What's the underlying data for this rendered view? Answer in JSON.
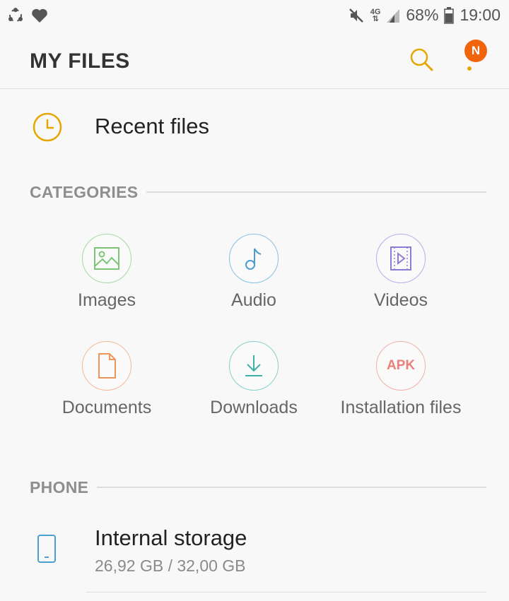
{
  "status_bar": {
    "network": "4G",
    "battery": "68%",
    "time": "19:00"
  },
  "app_bar": {
    "title": "MY FILES",
    "notification_badge": "N"
  },
  "recent": {
    "label": "Recent files"
  },
  "categories": {
    "header": "CATEGORIES",
    "items": [
      {
        "label": "Images",
        "icon": "image-icon",
        "color": "#7cc576"
      },
      {
        "label": "Audio",
        "icon": "music-note-icon",
        "color": "#4a9fd0"
      },
      {
        "label": "Videos",
        "icon": "video-icon",
        "color": "#8f7ad6"
      },
      {
        "label": "Documents",
        "icon": "document-icon",
        "color": "#f0955a"
      },
      {
        "label": "Downloads",
        "icon": "download-icon",
        "color": "#3fb1a6"
      },
      {
        "label": "Installation files",
        "icon_text": "APK",
        "color": "#e8817a"
      }
    ]
  },
  "phone": {
    "header": "PHONE",
    "storage_name": "Internal storage",
    "storage_size": "26,92 GB / 32,00 GB"
  },
  "colors": {
    "accent": "#e5a700",
    "badge": "#f0650c",
    "background": "#f8f8f8"
  }
}
